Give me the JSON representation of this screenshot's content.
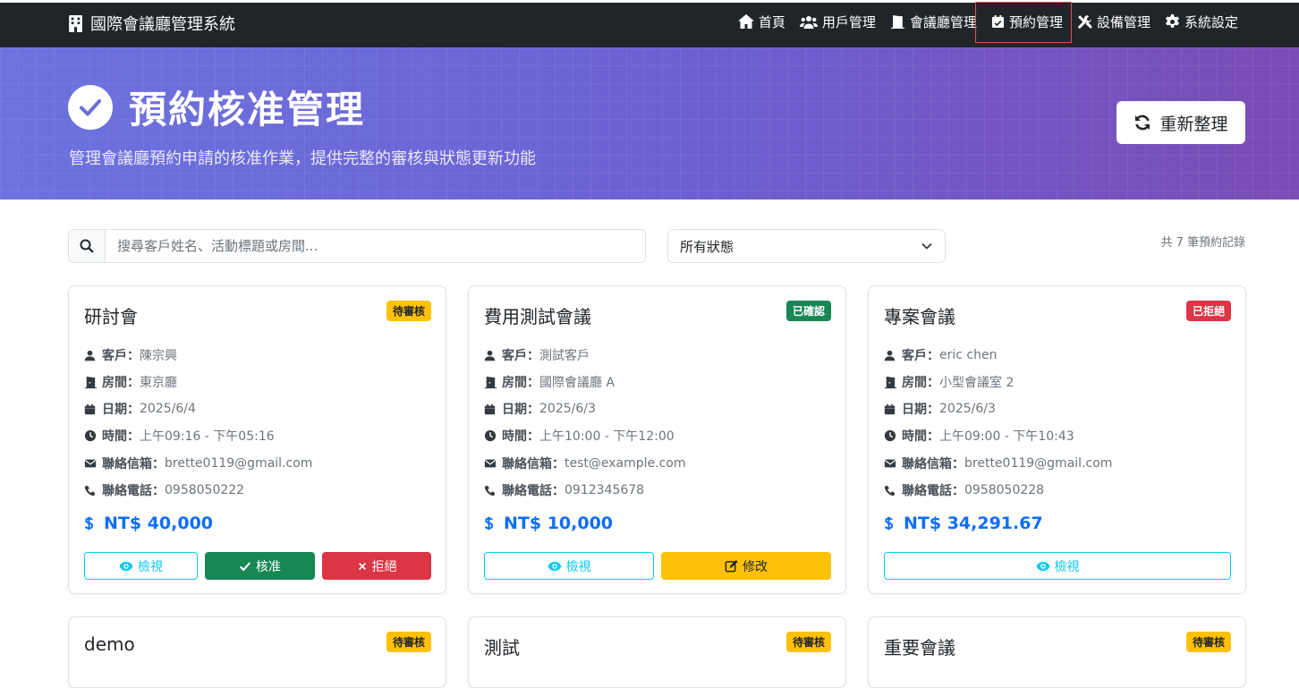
{
  "navbar": {
    "brand": "國際會議廳管理系統",
    "items": [
      {
        "label": "首頁",
        "icon": "home-icon"
      },
      {
        "label": "用戶管理",
        "icon": "users-icon"
      },
      {
        "label": "會議廳管理",
        "icon": "door-icon"
      },
      {
        "label": "預約管理",
        "icon": "calendar-check-icon"
      },
      {
        "label": "設備管理",
        "icon": "tools-icon"
      },
      {
        "label": "系統設定",
        "icon": "gear-icon"
      }
    ]
  },
  "hero": {
    "title": "預約核准管理",
    "subtitle": "管理會議廳預約申請的核准作業，提供完整的審核與狀態更新功能",
    "refresh_label": "重新整理"
  },
  "filters": {
    "search_placeholder": "搜尋客戶姓名、活動標題或房間...",
    "status_selected": "所有狀態",
    "record_count": "共 7 筆預約記錄"
  },
  "labels": {
    "customer": "客戶：",
    "room": "房間：",
    "date": "日期：",
    "time": "時間：",
    "email": "聯絡信箱：",
    "phone": "聯絡電話："
  },
  "buttons": {
    "view": "檢視",
    "approve": "核准",
    "reject": "拒絕",
    "edit": "修改"
  },
  "colors": {
    "navbar": "#212529",
    "pending": "#ffc107",
    "confirmed": "#198754",
    "rejected": "#dc3545",
    "price": "#0d6efd",
    "view": "#0dcaf0"
  },
  "bookings": [
    {
      "title": "研討會",
      "status": "待審核",
      "customer": "陳宗興",
      "room": "東京廳",
      "date": "2025/6/4",
      "time": "上午09:16 - 下午05:16",
      "email": "brette0119@gmail.com",
      "phone": "0958050222",
      "price": "NT$ 40,000"
    },
    {
      "title": "費用測試會議",
      "status": "已確認",
      "customer": "測試客戶",
      "room": "國際會議廳 A",
      "date": "2025/6/3",
      "time": "上午10:00 - 下午12:00",
      "email": "test@example.com",
      "phone": "0912345678",
      "price": "NT$ 10,000"
    },
    {
      "title": "專案會議",
      "status": "已拒絕",
      "customer": "eric chen",
      "room": "小型會議室 2",
      "date": "2025/6/3",
      "time": "上午09:00 - 下午10:43",
      "email": "brette0119@gmail.com",
      "phone": "0958050228",
      "price": "NT$ 34,291.67"
    },
    {
      "title": "demo",
      "status": "待審核"
    },
    {
      "title": "測試",
      "status": "待審核"
    },
    {
      "title": "重要會議",
      "status": "待審核"
    }
  ]
}
